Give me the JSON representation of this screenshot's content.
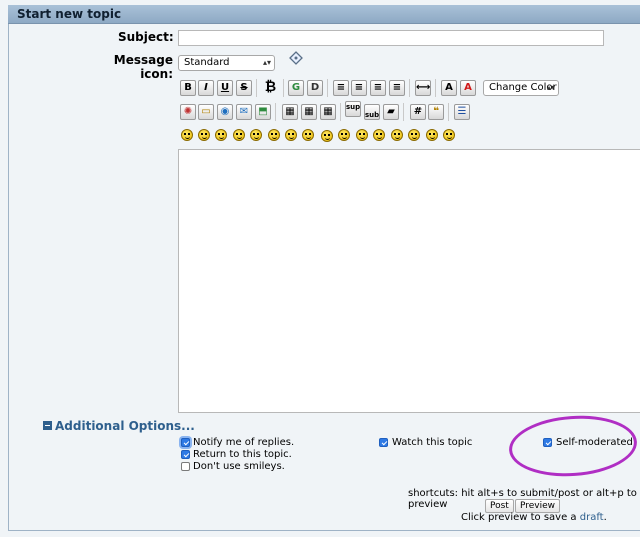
{
  "header": {
    "title": "Start new topic"
  },
  "form": {
    "subject_label": "Subject:",
    "subject_value": "",
    "icon_label": "Message icon:",
    "icon_select_value": "Standard",
    "change_color_value": "Change Color",
    "additional_options": "Additional Options...",
    "options": {
      "notify": "Notify me of replies.",
      "return_topic": "Return to this topic.",
      "no_smileys": "Don't use smileys.",
      "watch": "Watch this topic",
      "self_moderated": "Self-moderated"
    },
    "shortcuts": "shortcuts: hit alt+s to submit/post or alt+p to preview",
    "post_button": "Post",
    "preview_button": "Preview",
    "draft_prefix": "Click preview to save a",
    "draft_link": "draft",
    "draft_suffix": "."
  },
  "toolbar": {
    "bold": "B",
    "italic": "I",
    "underline": "U",
    "strike": "S",
    "font_size": "A",
    "font_color": "A",
    "code": "#",
    "sup": "sup",
    "sub": "sub"
  },
  "highlight_color": "#b02ec4"
}
